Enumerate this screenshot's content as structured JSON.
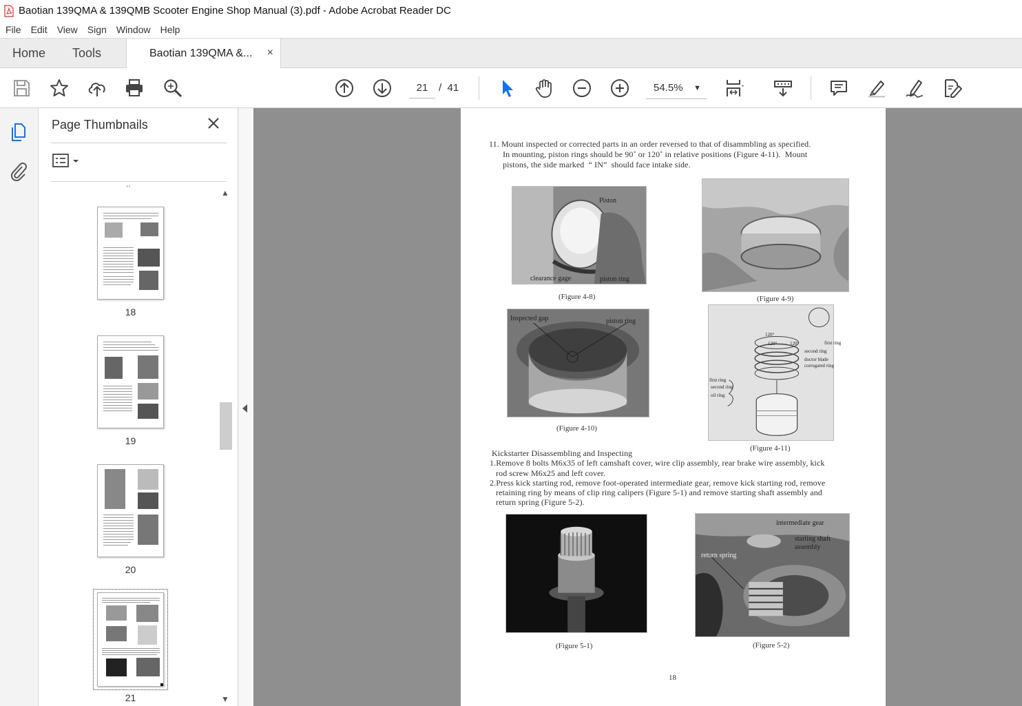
{
  "window": {
    "title": "Baotian 139QMA & 139QMB Scooter Engine Shop Manual (3).pdf - Adobe Acrobat Reader DC"
  },
  "menu": [
    "File",
    "Edit",
    "View",
    "Sign",
    "Window",
    "Help"
  ],
  "tabs": {
    "home": "Home",
    "tools": "Tools",
    "document": "Baotian 139QMA &...",
    "close_symbol": "×"
  },
  "toolbar": {
    "current_page": "21",
    "page_separator": "/",
    "total_pages": "41",
    "zoom": "54.5%",
    "icons": [
      "save-icon",
      "bookmark-star-icon",
      "upload-cloud-icon",
      "print-icon",
      "search-zoom-icon",
      "previous-page-icon",
      "next-page-icon",
      "select-cursor-icon",
      "hand-tool-icon",
      "zoom-out-icon",
      "zoom-in-icon",
      "page-fit-icon",
      "scroll-mode-icon",
      "comment-icon",
      "highlight-pen-icon",
      "sign-icon",
      "edit-pdf-icon"
    ]
  },
  "sidebar": {
    "panel_title": "Page Thumbnails",
    "top_dots": "..",
    "thumbnails": [
      {
        "page": "18"
      },
      {
        "page": "19"
      },
      {
        "page": "20"
      },
      {
        "page": "21",
        "selected": true
      }
    ]
  },
  "document": {
    "step_11": [
      "11. Mount inspected or corrected parts in an order reversed to that of disammbling as specified.",
      "In mounting, piston rings should be 90˚ or 120˚ in relative positions (Figure 4-11).  Mount",
      "pistons, the side marked  “ IN”  should face intake side."
    ],
    "fig_4_8": {
      "caption": "(Figure 4-8)",
      "labels": [
        "Piston",
        "clearance gage",
        "piston ring"
      ]
    },
    "fig_4_9": {
      "caption": "(Figure 4-9)"
    },
    "fig_4_10": {
      "caption": "(Figure 4-10)",
      "labels": [
        "Inspected gap",
        "piston ring"
      ]
    },
    "fig_4_11": {
      "caption": "(Figure 4-11)",
      "labels": [
        "first ring",
        "second ring",
        "doctor blade corrugated ring",
        "first ring",
        "second ring",
        "oil ring",
        "120°",
        "120°",
        "120°"
      ]
    },
    "kickstarter_heading": "Kickstarter Disassembling and Inspecting",
    "step_1": [
      "1.Remove 8 bolts M6x35 of left camshaft cover, wire clip assembly, rear brake wire assembly, kick",
      "rod screw M6x25 and left cover."
    ],
    "step_2": [
      "2.Press kick starting rod, remove foot-operated intermediate gear, remove kick starting rod, remove",
      "retaining ring by means of clip ring calipers (Figure 5-1) and remove starting shaft assembly and",
      "return spring (Figure 5-2)."
    ],
    "fig_5_1": {
      "caption": "(Figure 5-1)"
    },
    "fig_5_2": {
      "caption": "(Figure 5-2)",
      "labels": [
        "intermediate gear",
        "starting shaft",
        "assembly",
        "return spring"
      ]
    },
    "page_number": "18"
  },
  "colors": {
    "accent": "#1473e6",
    "viewer_background": "#8f8f8f",
    "pdf_icon_red": "#d32e2e"
  }
}
